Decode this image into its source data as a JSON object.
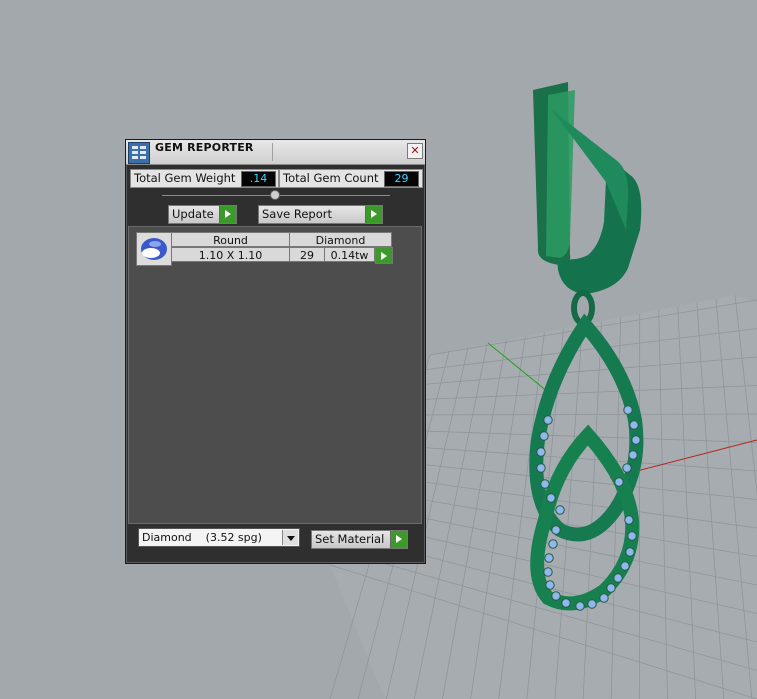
{
  "panel": {
    "title": "GEM REPORTER",
    "close_symbol": "✕",
    "total_weight_label": "Total Gem Weight",
    "total_weight_value": ".14",
    "total_count_label": "Total Gem Count",
    "total_count_value": "29",
    "update_label": "Update",
    "save_report_label": "Save Report",
    "gem": {
      "shape": "Round",
      "material": "Diamond",
      "size": "1.10 X 1.10",
      "count": "29",
      "weight": "0.14tw"
    },
    "material_select": "Diamond    (3.52 spg)",
    "set_material_label": "Set Material"
  },
  "colors": {
    "model_green": "#1d7a54",
    "gem_blue": "#8fb7f0",
    "accent_green": "#3c9a2a",
    "value_text": "#3fd4ff"
  }
}
